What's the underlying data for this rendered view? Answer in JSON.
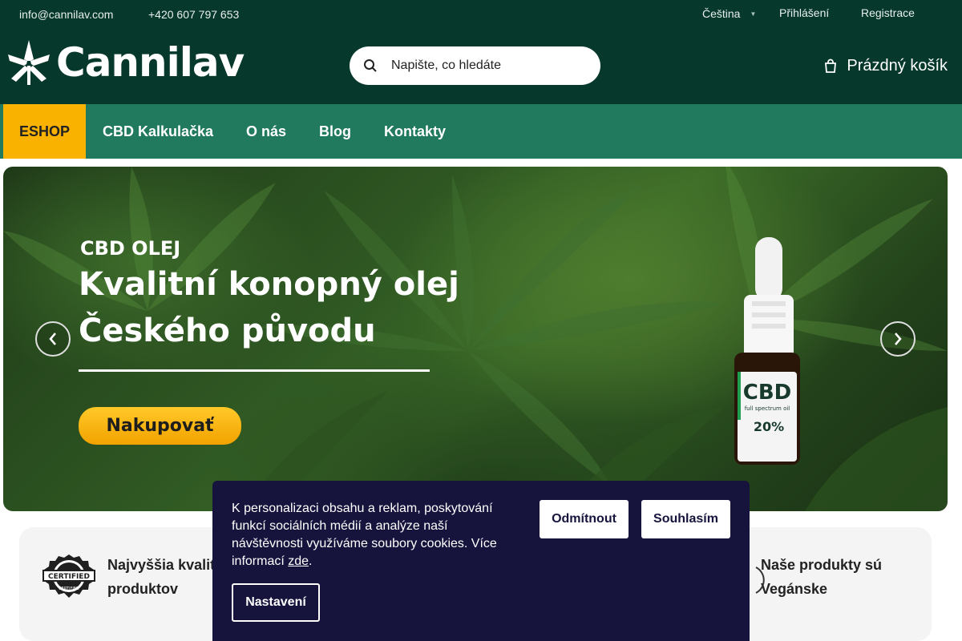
{
  "topbar": {
    "email": "info@cannilav.com",
    "phone": "+420 607 797 653",
    "language": "Čeština",
    "login": "Přihlášení",
    "register": "Registrace"
  },
  "header": {
    "logo_text": "Cannilav",
    "search_placeholder": "Napište, co hledáte",
    "cart_label": "Prázdný košík"
  },
  "nav": {
    "items": [
      {
        "label": "ESHOP",
        "active": true
      },
      {
        "label": "CBD Kalkulačka",
        "active": false
      },
      {
        "label": "O nás",
        "active": false
      },
      {
        "label": "Blog",
        "active": false
      },
      {
        "label": "Kontakty",
        "active": false
      }
    ]
  },
  "hero": {
    "eyebrow": "CBD OLEJ",
    "title_line1": "Kvalitní konopný olej",
    "title_line2": "Českého původu",
    "cta": "Nakupovať",
    "bottle_label_main": "CBD",
    "bottle_label_sub": "full spectrum oil",
    "bottle_percent": "20%"
  },
  "features": {
    "left_title_line1": "Najvyššia kvalit",
    "left_title_line2": "produktov",
    "badge_text_top": "CERTIFIED",
    "badge_text_bottom": "CERTIFIED",
    "right_title_line1": "Naše produkty sú",
    "right_title_line2": "Vegánske"
  },
  "cookie": {
    "text": "K personalizaci obsahu a reklam, poskytování funkcí sociálních médií a analýze naší návštěvnosti využíváme soubory cookies. Více informací ",
    "link": "zde",
    "text_end": ".",
    "reject": "Odmítnout",
    "accept": "Souhlasím",
    "settings": "Nastavení"
  },
  "colors": {
    "header_bg": "#06382c",
    "nav_bg": "#227a5e",
    "nav_active": "#f9b200",
    "cookie_bg": "#16143c",
    "cta": "#f9b200"
  },
  "icons": [
    "cannabis-leaf-logo-icon",
    "search-icon",
    "cart-icon",
    "chevron-left-icon",
    "chevron-right-icon",
    "caret-down-icon",
    "certified-badge-icon",
    "vegan-icon"
  ]
}
